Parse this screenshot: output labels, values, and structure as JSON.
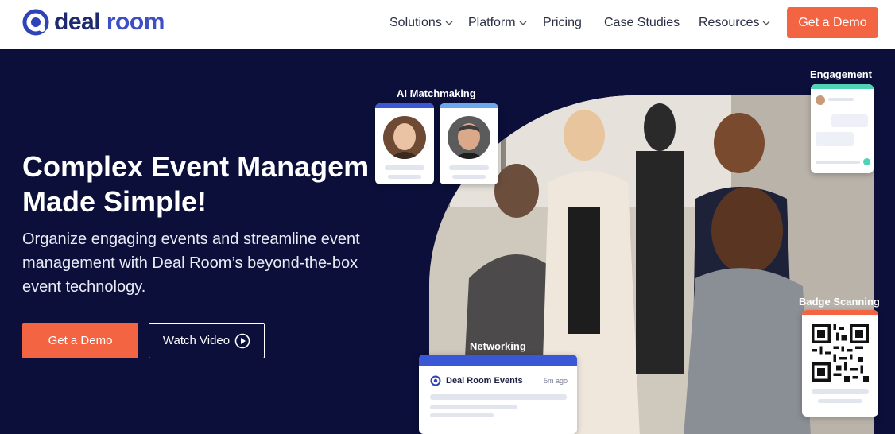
{
  "header": {
    "brand_deal": "deal",
    "brand_room": "room",
    "nav": [
      {
        "label": "Solutions",
        "has_dropdown": true
      },
      {
        "label": "Platform",
        "has_dropdown": true
      },
      {
        "label": "Pricing",
        "has_dropdown": false
      },
      {
        "label": "Case Studies",
        "has_dropdown": false
      },
      {
        "label": "Resources",
        "has_dropdown": true
      }
    ],
    "cta_label": "Get a Demo"
  },
  "hero": {
    "headline_line1": "Complex Event Managem",
    "headline_line2": "Made Simple!",
    "subtitle": "Organize engaging events and streamline event management with Deal Room’s beyond-the-box event technology.",
    "primary_button": "Get a Demo",
    "secondary_button": "Watch Video"
  },
  "features": {
    "matchmaking_label": "AI Matchmaking",
    "engagement_label": "Engagement",
    "networking_label": "Networking",
    "badge_label": "Badge Scanning",
    "networking_card": {
      "title": "Deal Room Events",
      "time": "5m ago"
    }
  },
  "colors": {
    "brand_navy": "#0b0f3a",
    "accent_orange": "#f26442",
    "brand_blue": "#3d4fc4",
    "card_blue": "#3a57d6",
    "card_light_blue": "#6aa8ee",
    "card_teal": "#4fd3b4",
    "card_orange": "#f26442"
  },
  "icons": {
    "logo": "deal-room-logo-icon",
    "dropdown": "chevron-down-icon",
    "play": "play-circle-icon",
    "qr": "qr-code-icon"
  }
}
